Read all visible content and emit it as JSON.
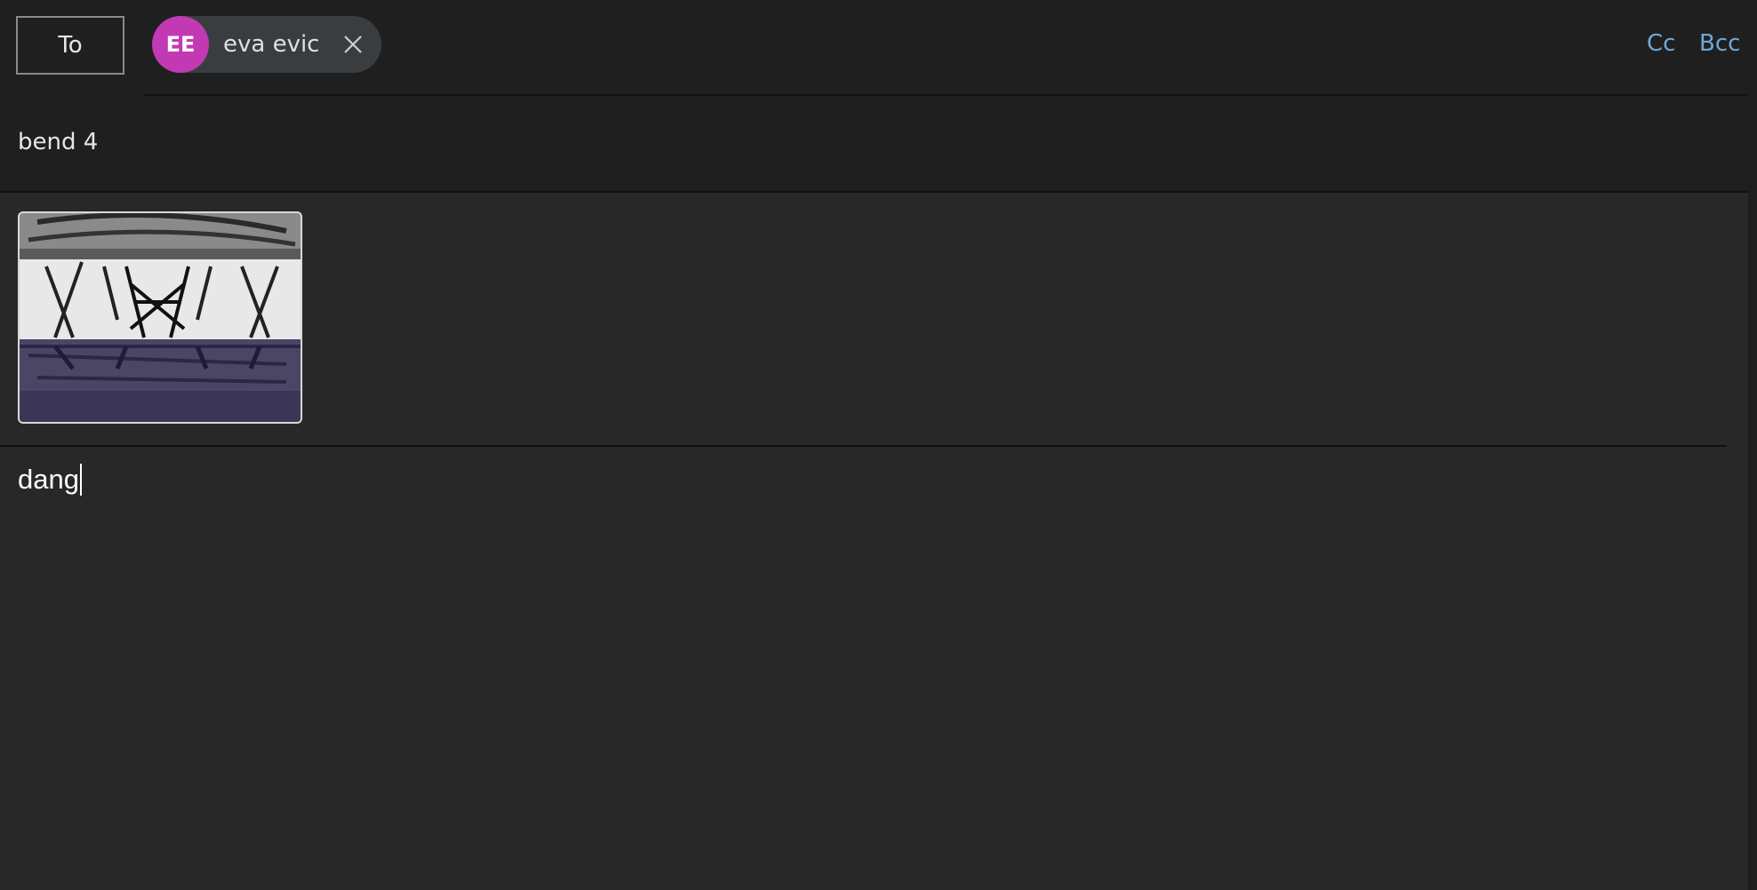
{
  "compose": {
    "to_label": "To",
    "recipients": [
      {
        "initials": "EE",
        "name": "eva evic",
        "avatar_color": "#c239b3"
      }
    ],
    "cc_label": "Cc",
    "bcc_label": "Bcc",
    "subject": "bend 4",
    "body_text": "dang",
    "attachment_icon": "inline-image-thumbnail"
  },
  "colors": {
    "link_accent": "#6fa8d6",
    "background": "#282828",
    "chip_background": "#3a3d40"
  }
}
